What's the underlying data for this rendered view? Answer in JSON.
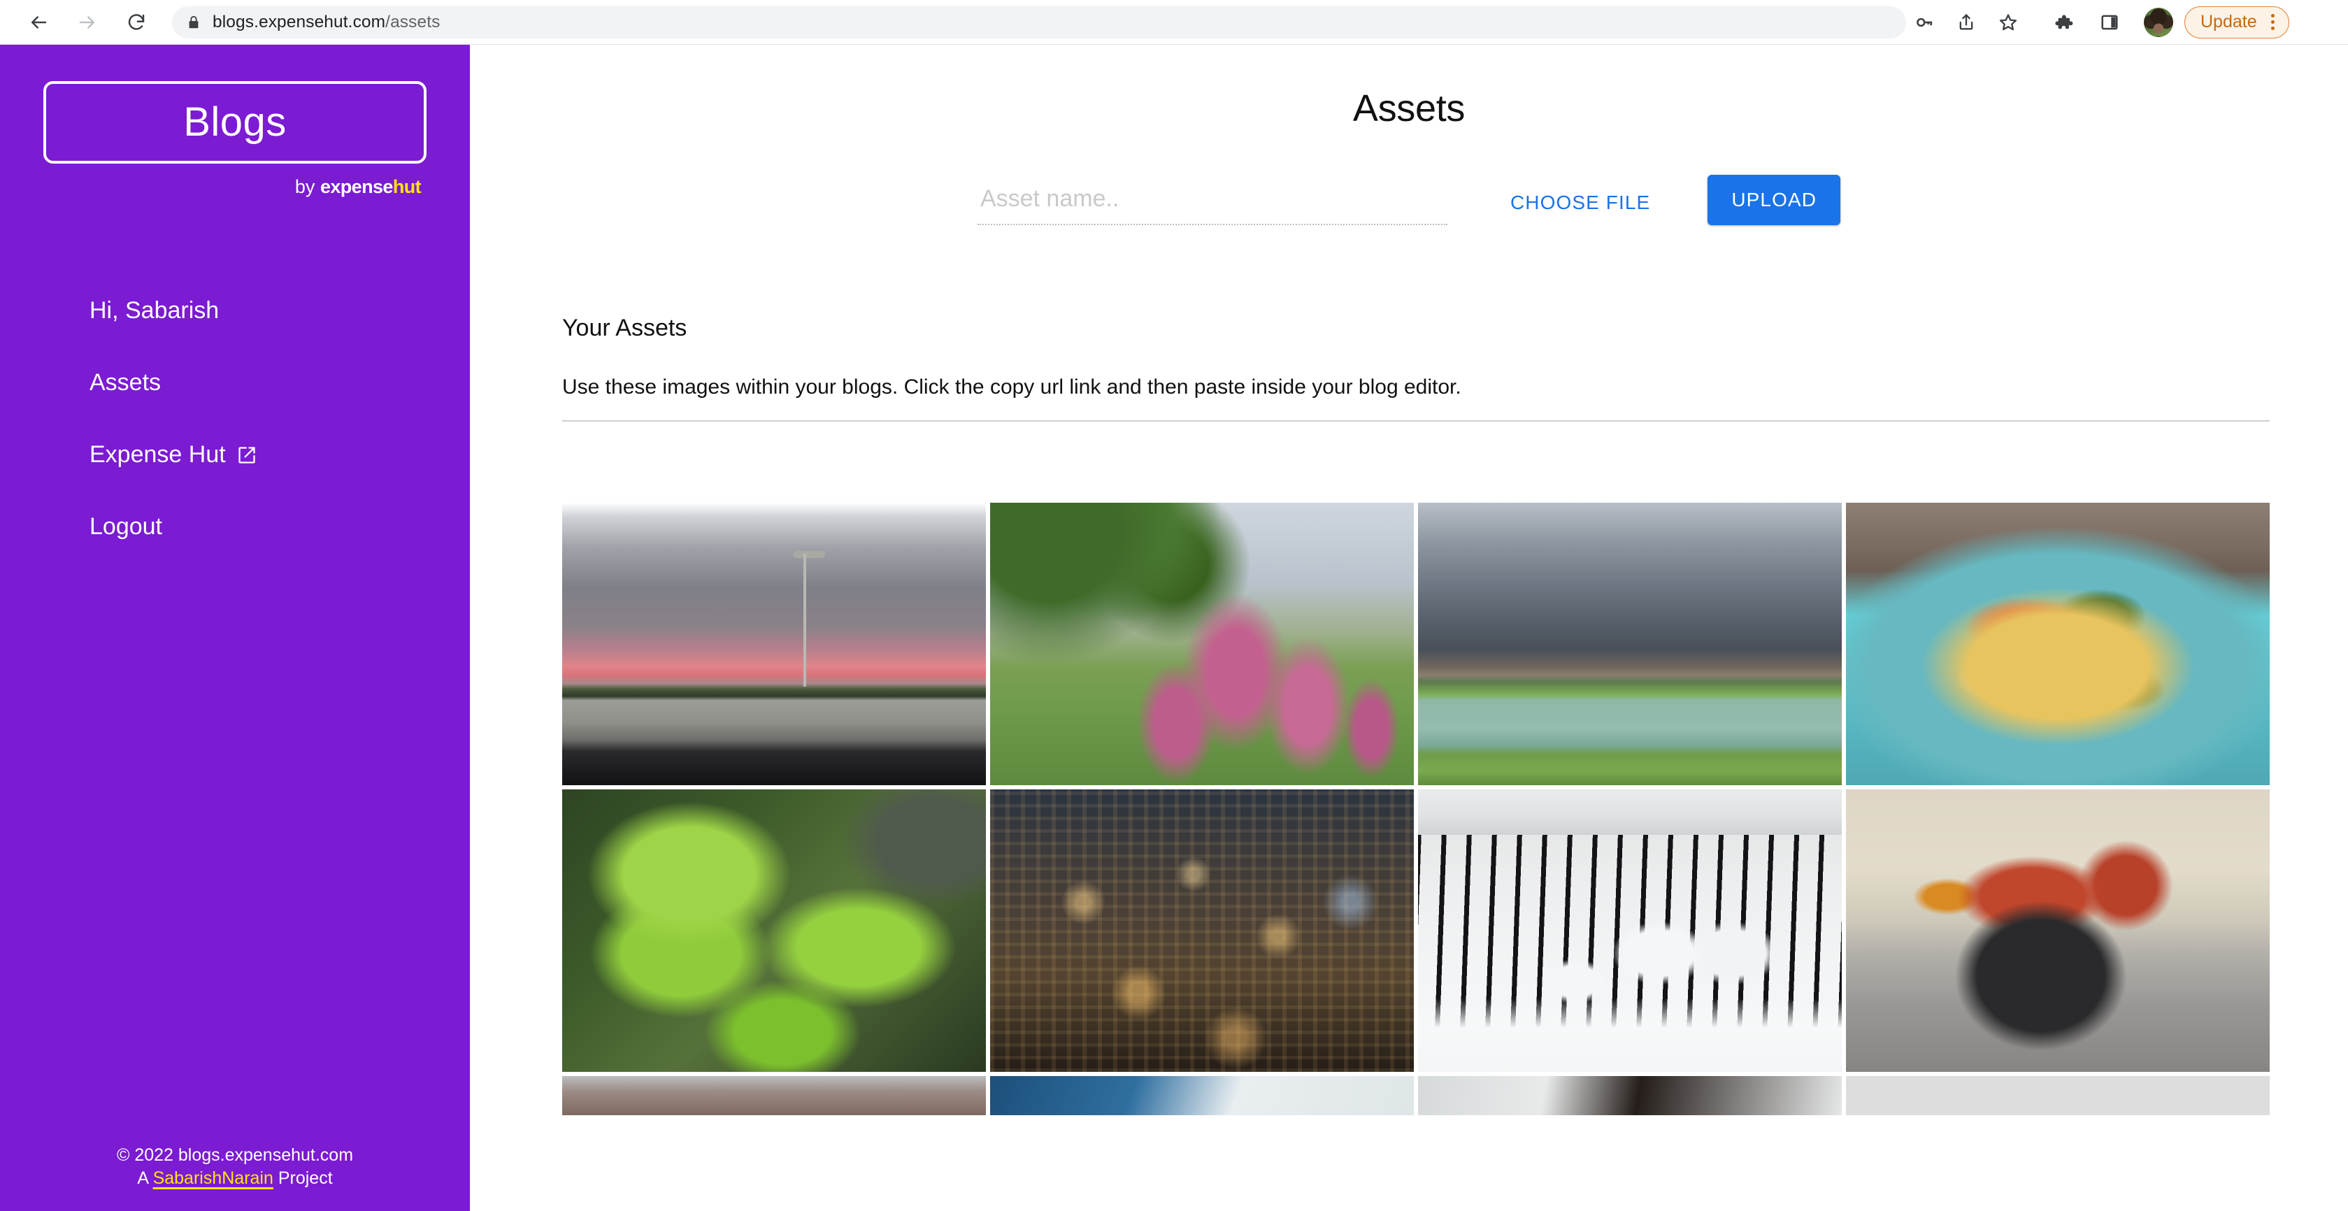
{
  "browser": {
    "back_icon": "back-arrow-icon",
    "forward_icon": "forward-arrow-icon",
    "reload_icon": "reload-icon",
    "lock_icon": "lock-icon",
    "url_domain": "blogs.expensehut.com",
    "url_path": "/assets",
    "actions": [
      {
        "name": "password-manager-icon",
        "label": "key"
      },
      {
        "name": "share-icon",
        "label": "share"
      },
      {
        "name": "bookmark-star-icon",
        "label": "star"
      },
      {
        "name": "extensions-puzzle-icon",
        "label": "puzzle"
      },
      {
        "name": "side-panel-icon",
        "label": "panel"
      }
    ],
    "update_label": "Update",
    "menu_icon": "three-dot-menu-icon",
    "accent_orange": "#c5690f"
  },
  "sidebar": {
    "logo_title": "Blogs",
    "byline_by": "by ",
    "byline_expense": "expense",
    "byline_hut": "hut",
    "brand_purple": "#7B1BD2",
    "brand_yellow": "#FFE313",
    "items": [
      {
        "label": "Hi, Sabarish",
        "name": "sidebar-item-greeting",
        "interactable": false,
        "external": false
      },
      {
        "label": "Assets",
        "name": "sidebar-item-assets",
        "interactable": true,
        "external": false
      },
      {
        "label": "Expense Hut",
        "name": "sidebar-item-expense-hut",
        "interactable": true,
        "external": true
      },
      {
        "label": "Logout",
        "name": "sidebar-item-logout",
        "interactable": true,
        "external": false
      }
    ],
    "footer_copyright": "© 2022 blogs.expensehut.com",
    "footer_prefix": "A ",
    "footer_link": "SabarishNarain",
    "footer_suffix": " Project"
  },
  "main": {
    "title": "Assets",
    "upload": {
      "input_value": "",
      "input_placeholder": "Asset name..",
      "choose_file_label": "CHOOSE FILE",
      "upload_label": "UPLOAD",
      "button_blue": "#1a73e8"
    },
    "assets": {
      "heading": "Your Assets",
      "description": "Use these images within your blogs. Click the copy url link and then paste inside your blog editor.",
      "tiles": [
        {
          "name": "asset-thumbnail-highway-sunset",
          "art": "art-highway",
          "alt": "Highway at sunset seen through car windshield"
        },
        {
          "name": "asset-thumbnail-pink-flowers",
          "art": "art-flowers",
          "alt": "Pink astilbe flowers with green foliage"
        },
        {
          "name": "asset-thumbnail-storm-lake",
          "art": "art-lake",
          "alt": "Storm clouds over lake with apartment buildings"
        },
        {
          "name": "asset-thumbnail-pasta-plate",
          "art": "art-pasta",
          "alt": "Pasta with vegetables on a teal plate"
        },
        {
          "name": "asset-thumbnail-green-leaves",
          "art": "art-leaves",
          "alt": "Macro close-up of bright green leaves"
        },
        {
          "name": "asset-thumbnail-night-skyline",
          "art": "art-city",
          "alt": "City skyline at night with lit skyscrapers"
        },
        {
          "name": "asset-thumbnail-snowy-balcony",
          "art": "art-snow",
          "alt": "Snow covered potted plants on balcony railing"
        },
        {
          "name": "asset-thumbnail-red-motorcycle",
          "art": "art-moto",
          "alt": "Red motorcycle parked in a garage"
        }
      ],
      "partial_tiles": [
        {
          "name": "asset-thumbnail-partial-1",
          "art": "art-p1"
        },
        {
          "name": "asset-thumbnail-partial-2",
          "art": "art-p2"
        },
        {
          "name": "asset-thumbnail-partial-3",
          "art": "art-p3"
        },
        {
          "name": "asset-thumbnail-partial-4",
          "art": "art-p4"
        }
      ]
    }
  }
}
